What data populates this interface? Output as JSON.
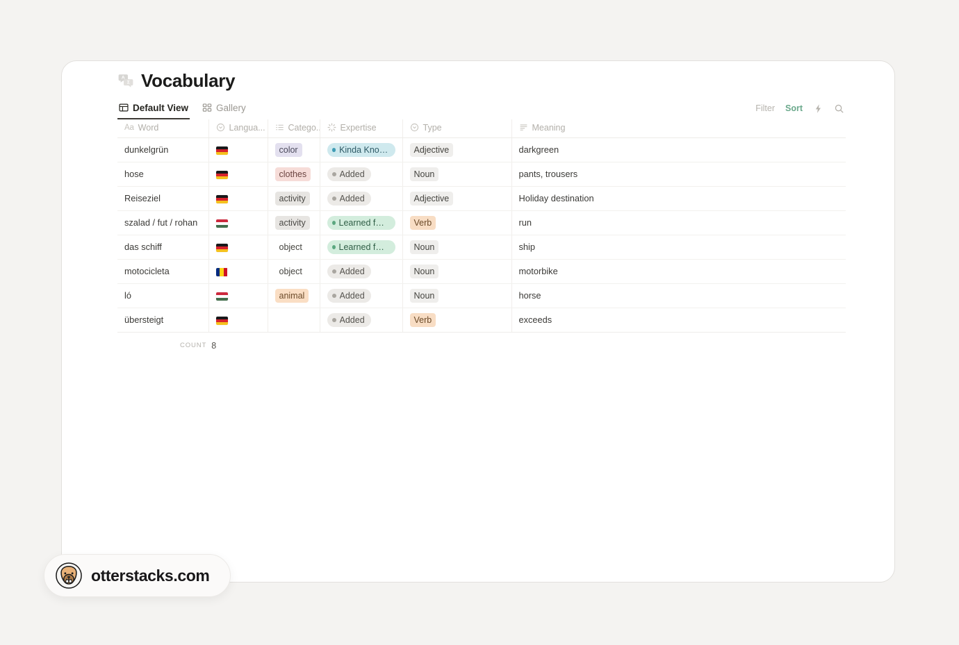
{
  "page": {
    "title": "Vocabulary",
    "title_icon": "translate-bubbles-icon"
  },
  "tabs": [
    {
      "label": "Default View",
      "icon": "table-grid-icon",
      "active": true
    },
    {
      "label": "Gallery",
      "icon": "gallery-grid-icon",
      "active": false
    }
  ],
  "toolbar": {
    "filter_label": "Filter",
    "sort_label": "Sort",
    "lightning_icon": "lightning-bolt-icon",
    "search_icon": "search-icon",
    "sort_color": "#6ba98c"
  },
  "table": {
    "columns": [
      {
        "key": "word",
        "label": "Word",
        "icon": "aa-text-icon"
      },
      {
        "key": "language",
        "label": "Langua...",
        "icon": "select-circle-icon"
      },
      {
        "key": "category",
        "label": "Catego...",
        "icon": "multi-select-list-icon"
      },
      {
        "key": "expertise",
        "label": "Expertise",
        "icon": "status-spinner-icon"
      },
      {
        "key": "type",
        "label": "Type",
        "icon": "select-circle-icon"
      },
      {
        "key": "meaning",
        "label": "Meaning",
        "icon": "text-lines-icon"
      }
    ],
    "rows": [
      {
        "word": "dunkelgrün",
        "language": {
          "flag": "germany-flag",
          "colors": [
            "#18181a",
            "#d8232c",
            "#f5c11e"
          ],
          "orientation": "horizontal"
        },
        "category": {
          "text": "color",
          "bg": "#e3e0ef",
          "fg": "#4b4a5c"
        },
        "expertise": {
          "text": "Kinda Know It",
          "bg": "#cfe9ee",
          "fg": "#2e5a66",
          "dot": "#3f9cb5"
        },
        "type": {
          "text": "Adjective",
          "bg": "#efeeec",
          "fg": "#45443f"
        },
        "meaning": "darkgreen"
      },
      {
        "word": "hose",
        "language": {
          "flag": "germany-flag",
          "colors": [
            "#18181a",
            "#d8232c",
            "#f5c11e"
          ],
          "orientation": "horizontal"
        },
        "category": {
          "text": "clothes",
          "bg": "#f6dcd8",
          "fg": "#6b4441"
        },
        "expertise": {
          "text": "Added",
          "bg": "#eceae7",
          "fg": "#55534e",
          "dot": "#a9a6a0"
        },
        "type": {
          "text": "Noun",
          "bg": "#efeeec",
          "fg": "#45443f"
        },
        "meaning": "pants, trousers"
      },
      {
        "word": "Reiseziel",
        "language": {
          "flag": "germany-flag",
          "colors": [
            "#18181a",
            "#d8232c",
            "#f5c11e"
          ],
          "orientation": "horizontal"
        },
        "category": {
          "text": "activity",
          "bg": "#e7e5e2",
          "fg": "#4b4a46"
        },
        "expertise": {
          "text": "Added",
          "bg": "#eceae7",
          "fg": "#55534e",
          "dot": "#a9a6a0"
        },
        "type": {
          "text": "Adjective",
          "bg": "#efeeec",
          "fg": "#45443f"
        },
        "meaning": "Holiday destination"
      },
      {
        "word": "szalad / fut / rohan",
        "language": {
          "flag": "hungary-flag",
          "colors": [
            "#cd2a3e",
            "#ffffff",
            "#436f4d"
          ],
          "orientation": "horizontal"
        },
        "category": {
          "text": "activity",
          "bg": "#e7e5e2",
          "fg": "#4b4a46"
        },
        "expertise": {
          "text": "Learned for S...",
          "bg": "#d3eddd",
          "fg": "#2f5e46",
          "dot": "#5aa77f"
        },
        "type": {
          "text": "Verb",
          "bg": "#f8ddc4",
          "fg": "#6b4a28"
        },
        "meaning": "run"
      },
      {
        "word": "das schiff",
        "language": {
          "flag": "germany-flag",
          "colors": [
            "#18181a",
            "#d8232c",
            "#f5c11e"
          ],
          "orientation": "horizontal"
        },
        "category": {
          "text": "object",
          "bg": "transparent",
          "fg": "#45443f"
        },
        "expertise": {
          "text": "Learned for S...",
          "bg": "#d3eddd",
          "fg": "#2f5e46",
          "dot": "#5aa77f"
        },
        "type": {
          "text": "Noun",
          "bg": "#efeeec",
          "fg": "#45443f"
        },
        "meaning": "ship"
      },
      {
        "word": "motocicleta",
        "language": {
          "flag": "romania-flag",
          "colors": [
            "#002b7f",
            "#fcd116",
            "#ce1126"
          ],
          "orientation": "vertical"
        },
        "category": {
          "text": "object",
          "bg": "transparent",
          "fg": "#45443f"
        },
        "expertise": {
          "text": "Added",
          "bg": "#eceae7",
          "fg": "#55534e",
          "dot": "#a9a6a0"
        },
        "type": {
          "text": "Noun",
          "bg": "#efeeec",
          "fg": "#45443f"
        },
        "meaning": "motorbike"
      },
      {
        "word": "ló",
        "language": {
          "flag": "hungary-flag",
          "colors": [
            "#cd2a3e",
            "#ffffff",
            "#436f4d"
          ],
          "orientation": "horizontal"
        },
        "category": {
          "text": "animal",
          "bg": "#fadec4",
          "fg": "#6d4c2b"
        },
        "expertise": {
          "text": "Added",
          "bg": "#eceae7",
          "fg": "#55534e",
          "dot": "#a9a6a0"
        },
        "type": {
          "text": "Noun",
          "bg": "#efeeec",
          "fg": "#45443f"
        },
        "meaning": "horse"
      },
      {
        "word": "übersteigt",
        "language": {
          "flag": "germany-flag",
          "colors": [
            "#18181a",
            "#d8232c",
            "#f5c11e"
          ],
          "orientation": "horizontal"
        },
        "category": {
          "text": "",
          "bg": "transparent",
          "fg": "#45443f"
        },
        "expertise": {
          "text": "Added",
          "bg": "#eceae7",
          "fg": "#55534e",
          "dot": "#a9a6a0"
        },
        "type": {
          "text": "Verb",
          "bg": "#f8ddc4",
          "fg": "#6b4a28"
        },
        "meaning": "exceeds"
      }
    ]
  },
  "footer": {
    "count_label": "COUNT",
    "count_value": "8"
  },
  "brand": {
    "text": "otterstacks.com",
    "icon": "otter-avatar-icon"
  }
}
